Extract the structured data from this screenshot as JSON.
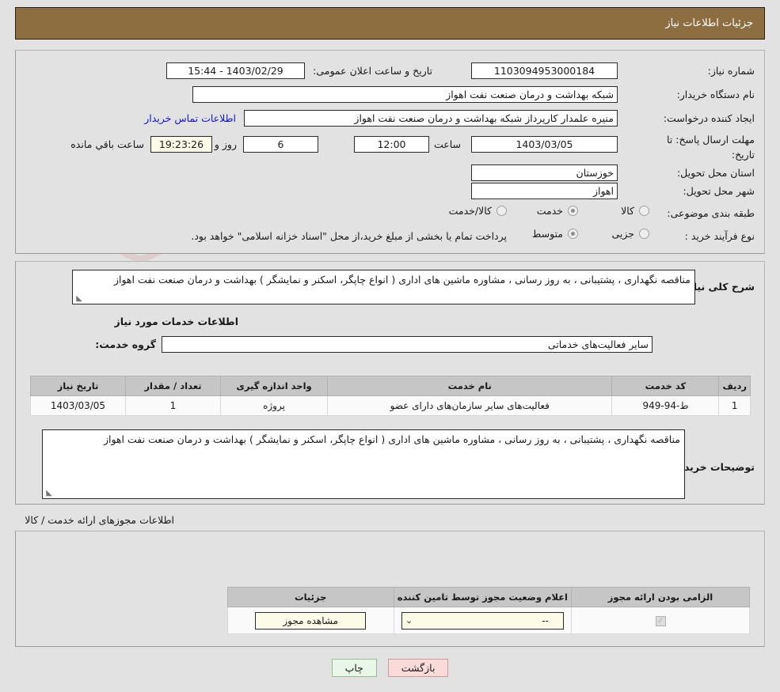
{
  "header": {
    "title": "جزئیات اطلاعات نیاز"
  },
  "form": {
    "need_number_label": "شماره نیاز:",
    "need_number_value": "1103094953000184",
    "announce_label": "تاریخ و ساعت اعلان عمومی:",
    "announce_value": "1403/02/29 - 15:44",
    "buyer_org_label": "نام دستگاه خریدار:",
    "buyer_org_value": "شبکه بهداشت و درمان صنعت نفت اهواز",
    "creator_label": "ایجاد کننده درخواست:",
    "creator_value": "منیره علمدار کارپرداز شبکه بهداشت و درمان صنعت نفت اهواز",
    "contact_link": "اطلاعات تماس خریدار",
    "deadline_label": "مهلت ارسال پاسخ: تا تاریخ:",
    "deadline_date": "1403/03/05",
    "hour_label": "ساعت",
    "deadline_time": "12:00",
    "days_remaining": "6",
    "days_label": "روز و",
    "time_remaining": "19:23:26",
    "remaining_suffix": "ساعت باقي مانده",
    "province_label": "استان محل تحویل:",
    "province_value": "خوزستان",
    "city_label": "شهر محل تحویل:",
    "city_value": "اهواز",
    "category_label": "طبقه بندی موضوعی:",
    "category_options": [
      {
        "label": "کالا",
        "selected": false
      },
      {
        "label": "خدمت",
        "selected": true
      },
      {
        "label": "کالا/خدمت",
        "selected": false
      }
    ],
    "process_label": "نوع فرآیند خرید :",
    "process_options": [
      {
        "label": "جزیی",
        "selected": false
      },
      {
        "label": "متوسط",
        "selected": true
      }
    ],
    "payment_note": "پرداخت تمام یا بخشی از مبلغ خرید،از محل \"اسناد خزانه اسلامی\" خواهد بود."
  },
  "description": {
    "general_need_label": "شرح کلی نیاز:",
    "general_need_value": "مناقصه نگهداری ، پشتیبانی ، به روز رسانی ، مشاوره ماشین های اداری ( انواع چاپگر، اسکنر و نمایشگر ) بهداشت و درمان صنعت نفت اهواز",
    "services_info_title": "اطلاعات خدمات مورد نیاز",
    "service_group_label": "گروه خدمت:",
    "service_group_value": "سایر فعالیت‌های خدماتی",
    "buyer_notes_label": "توضیحات خریدار:",
    "buyer_notes_value": "مناقصه نگهداری ، پشتیبانی ، به روز رسانی ، مشاوره ماشین های اداری ( انواع چاپگر، اسکنر و نمایشگر ) بهداشت و درمان صنعت نفت اهواز"
  },
  "services_table": {
    "headers": [
      "ردیف",
      "کد خدمت",
      "نام خدمت",
      "واحد اندازه گیری",
      "تعداد / مقدار",
      "تاریخ نیاز"
    ],
    "rows": [
      {
        "row": "1",
        "code": "ط-94-949",
        "name": "فعالیت‌های سایر سازمان‌های دارای عضو",
        "unit": "پروژه",
        "quantity": "1",
        "need_date": "1403/03/05"
      }
    ]
  },
  "permits": {
    "section_title": "اطلاعات مجوزهای ارائه خدمت / کالا",
    "headers": [
      "الزامی بودن ارائه مجوز",
      "اعلام وضعیت مجوز توسط تامین کننده",
      "جزئیات"
    ],
    "rows": [
      {
        "required": true,
        "status_value": "--",
        "details_label": "مشاهده مجوز"
      }
    ]
  },
  "footer": {
    "print_label": "چاپ",
    "back_label": "بازگشت"
  },
  "watermark": {
    "text": "AnaTender.net"
  },
  "colors": {
    "header_bar": "#8d6e41",
    "page_bg": "#e2e2e2",
    "link": "#1414d6",
    "print_btn": "#e8f7e8",
    "back_btn": "#fbdada"
  }
}
